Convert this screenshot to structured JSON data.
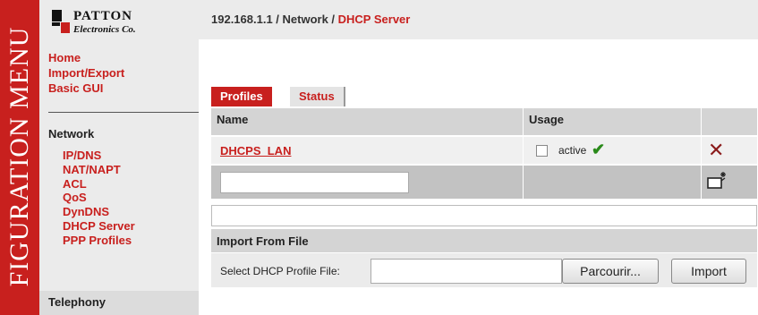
{
  "sidebar": {
    "banner": "FIGURATION MENU",
    "logo_line1": "PATTON",
    "logo_line2": "Electronics Co.",
    "top_links": [
      "Home",
      "Import/Export",
      "Basic GUI"
    ],
    "network_header": "Network",
    "network_items": [
      "IP/DNS",
      "NAT/NAPT",
      "ACL",
      "QoS",
      "DynDNS",
      "DHCP Server",
      "PPP Profiles"
    ],
    "telephony_header": "Telephony"
  },
  "breadcrumb": {
    "base": "192.168.1.1 / Network / ",
    "current": "DHCP Server"
  },
  "tabs": {
    "profiles": "Profiles",
    "status": "Status"
  },
  "table": {
    "col_name": "Name",
    "col_usage": "Usage",
    "profile_name": "DHCPS_LAN",
    "usage_label": "active"
  },
  "import": {
    "header": "Import From File",
    "file_label": "Select DHCP Profile File:",
    "browse_label": "Parcourir...",
    "import_label": "Import"
  },
  "icons": {
    "check": "check-icon",
    "delete": "delete-icon",
    "new": "new-profile-icon"
  },
  "colors": {
    "brand_red": "#c8201e",
    "check_green": "#2a8a1a"
  }
}
